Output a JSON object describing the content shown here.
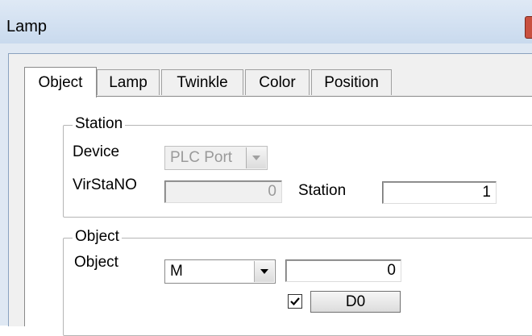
{
  "window": {
    "title": "Lamp"
  },
  "tabs": [
    {
      "label": "Object",
      "active": true
    },
    {
      "label": "Lamp",
      "active": false
    },
    {
      "label": "Twinkle",
      "active": false
    },
    {
      "label": "Color",
      "active": false
    },
    {
      "label": "Position",
      "active": false
    }
  ],
  "station_group": {
    "legend": "Station",
    "device_label": "Device",
    "device_value": "PLC Port",
    "virstano_label": "VirStaNO",
    "virstano_value": "0",
    "station_label": "Station",
    "station_value": "1"
  },
  "object_group": {
    "legend": "Object",
    "object_label": "Object",
    "object_type": "M",
    "object_address": "0",
    "checkbox_checked": true,
    "button_label": "D0"
  },
  "colors": {
    "titlebar": "#c9daee",
    "close": "#c8503f"
  }
}
